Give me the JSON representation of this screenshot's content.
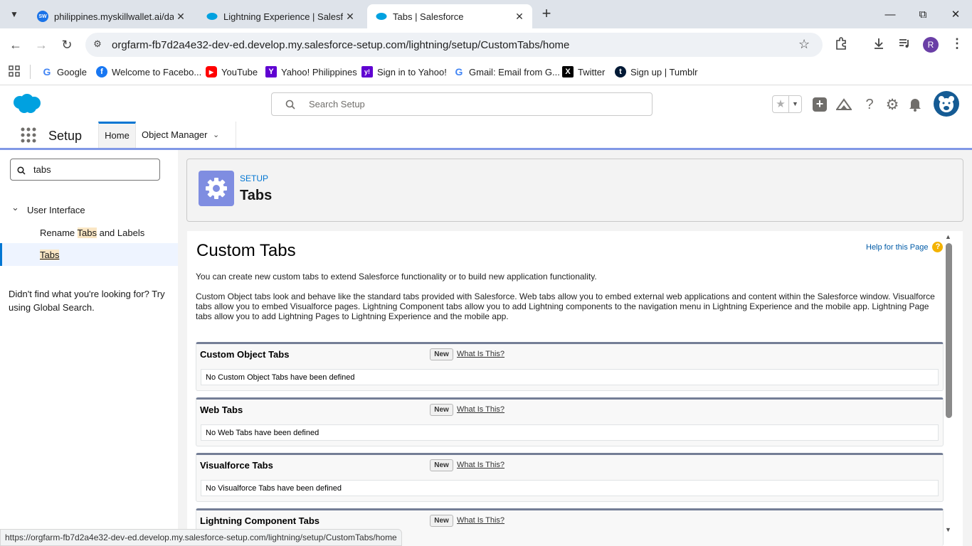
{
  "browser": {
    "tabs": [
      {
        "title": "philippines.myskillwallet.ai/dash",
        "favicon": "SW"
      },
      {
        "title": "Lightning Experience | Salesforce",
        "favicon": "salesforce-cloud"
      },
      {
        "title": "Tabs | Salesforce",
        "favicon": "salesforce-cloud"
      }
    ],
    "url": "orgfarm-fb7d2a4e32-dev-ed.develop.my.salesforce-setup.com/lightning/setup/CustomTabs/home",
    "profile_initial": "R",
    "bookmarks": [
      {
        "label": "Google"
      },
      {
        "label": "Welcome to Facebo..."
      },
      {
        "label": "YouTube"
      },
      {
        "label": "Yahoo! Philippines"
      },
      {
        "label": "Sign in to Yahoo!"
      },
      {
        "label": "Gmail: Email from G..."
      },
      {
        "label": "Twitter"
      },
      {
        "label": "Sign up | Tumblr"
      }
    ],
    "status_url": "https://orgfarm-fb7d2a4e32-dev-ed.develop.my.salesforce-setup.com/lightning/setup/CustomTabs/home"
  },
  "header": {
    "search_placeholder": "Search Setup"
  },
  "nav": {
    "app_name": "Setup",
    "tabs": [
      {
        "label": "Home"
      },
      {
        "label": "Object Manager"
      }
    ]
  },
  "sidebar": {
    "quick_find_value": "tabs",
    "group_label": "User Interface",
    "item1_pre": "Rename ",
    "item1_hl": "Tabs",
    "item1_post": " and Labels",
    "item2": "Tabs",
    "not_found": "Didn't find what you're looking for? Try using Global Search."
  },
  "page_header": {
    "eyebrow": "SETUP",
    "title": "Tabs"
  },
  "content": {
    "title": "Custom Tabs",
    "help_link": "Help for this Page",
    "intro": "You can create new custom tabs to extend Salesforce functionality or to build new application functionality.",
    "desc": "Custom Object tabs look and behave like the standard tabs provided with Salesforce. Web tabs allow you to embed external web applications and content within the Salesforce window. Visualforce tabs allow you to embed Visualforce pages. Lightning Component tabs allow you to add Lightning components to the navigation menu in Lightning Experience and the mobile app. Lightning Page tabs allow you to add Lightning Pages to Lightning Experience and the mobile app.",
    "new_label": "New",
    "what_is_this": "What Is This?",
    "sections": [
      {
        "title": "Custom Object Tabs",
        "empty": "No Custom Object Tabs have been defined"
      },
      {
        "title": "Web Tabs",
        "empty": "No Web Tabs have been defined"
      },
      {
        "title": "Visualforce Tabs",
        "empty": "No Visualforce Tabs have been defined"
      },
      {
        "title": "Lightning Component Tabs",
        "empty": ""
      }
    ]
  },
  "colors": {
    "brand": "#00a1e0",
    "accent": "#0176d3",
    "setup_icon_bg": "#7f8de1"
  }
}
